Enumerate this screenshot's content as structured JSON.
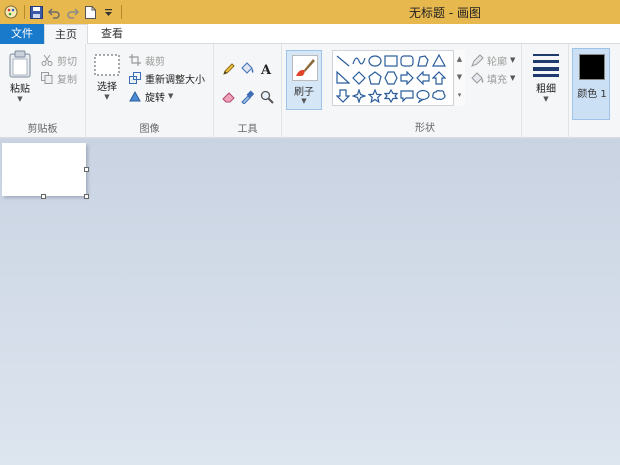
{
  "window": {
    "title": "无标题 - 画图"
  },
  "quick_access": [
    {
      "name": "paint-app-icon"
    },
    {
      "name": "save-icon"
    },
    {
      "name": "undo-icon"
    },
    {
      "name": "redo-icon"
    },
    {
      "name": "new-document-icon"
    },
    {
      "name": "customize-dropdown-icon"
    }
  ],
  "tabs": [
    {
      "label": "文件"
    },
    {
      "label": "主页"
    },
    {
      "label": "查看"
    }
  ],
  "clipboard": {
    "label": "剪贴板",
    "paste": "粘贴",
    "cut": "剪切",
    "copy": "复制"
  },
  "image": {
    "label": "图像",
    "select": "选择",
    "crop": "裁剪",
    "resize": "重新调整大小",
    "rotate": "旋转"
  },
  "tools": {
    "label": "工具"
  },
  "brushes": {
    "label": "刷子"
  },
  "shapes": {
    "label": "形状",
    "outline": "轮廓",
    "fill": "填充"
  },
  "size": {
    "label": "粗细"
  },
  "colors": {
    "color1_label": "颜色 1",
    "color1_value": "#000000"
  },
  "colors_accent": {
    "file_tab": "#1979ca",
    "titlebar": "#e6b84e"
  }
}
